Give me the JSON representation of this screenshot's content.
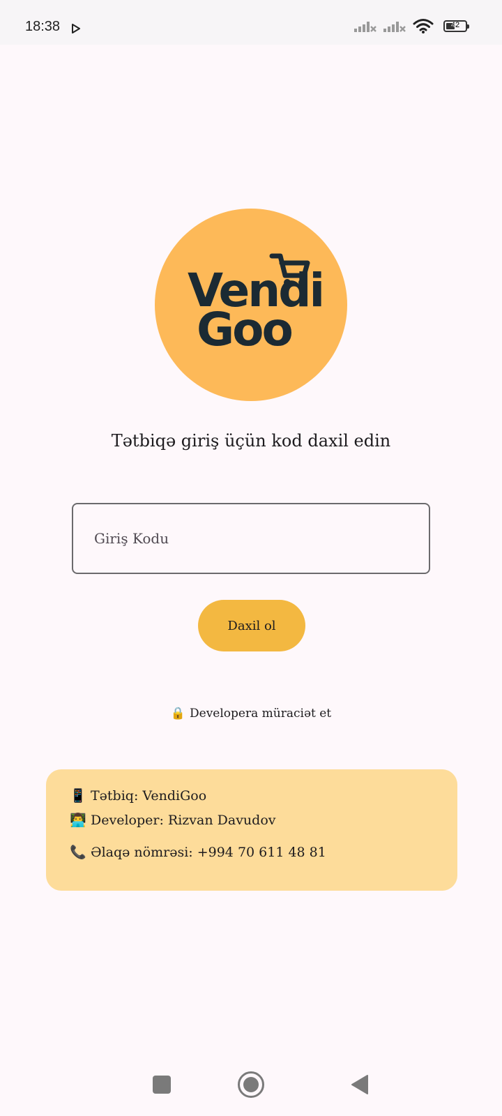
{
  "status_bar": {
    "time": "18:38",
    "battery": "42"
  },
  "logo": {
    "line1": "Vendi",
    "line2": "Goo",
    "circle_color": "#FDB958",
    "text_color": "#1B2A33"
  },
  "login": {
    "prompt": "Tətbiqə giriş üçün kod daxil edin",
    "code_placeholder": "Giriş Kodu",
    "code_value": "",
    "submit_label": "Daxil ol"
  },
  "developer_link": {
    "icon": "🔒",
    "label": "Developera müraciət et"
  },
  "info": {
    "app_icon": "📱",
    "app": "Tətbiq: VendiGoo",
    "developer_icon": "👨‍💻",
    "developer": "Developer: Rizvan Davudov",
    "phone_icon": "📞",
    "phone": "Əlaqə nömrəsi: +994 70 611 48 81"
  },
  "colors": {
    "background": "#FEF8FB",
    "button": "#F3B841",
    "info_card": "#FDDC9A"
  }
}
